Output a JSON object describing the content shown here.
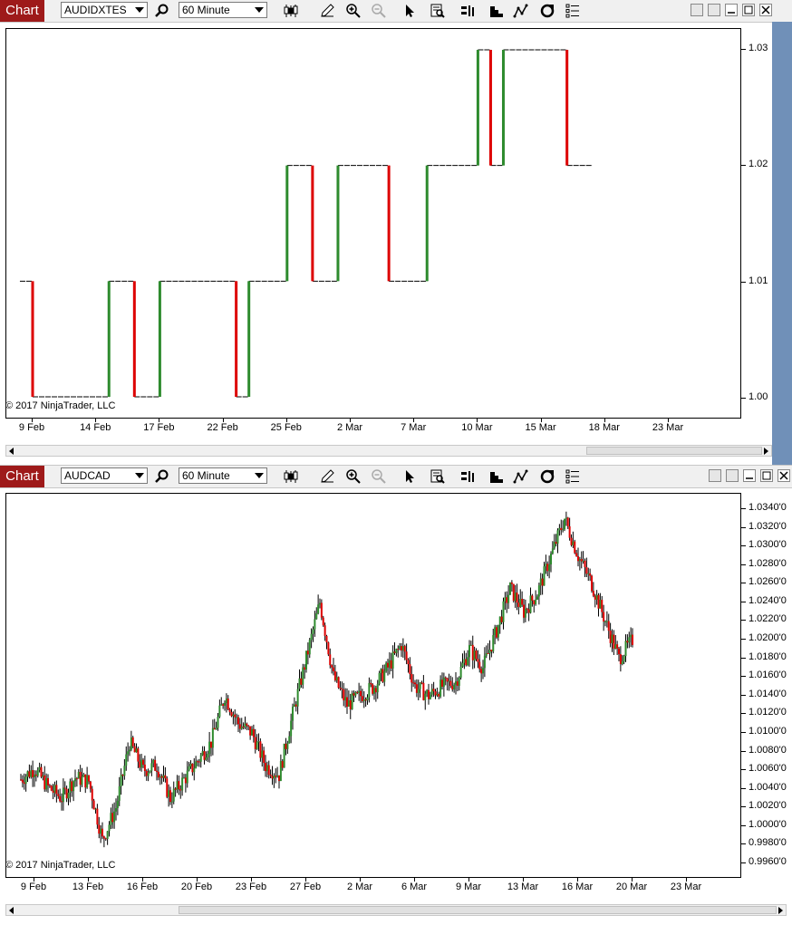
{
  "windows": [
    {
      "title": "Chart",
      "instrument": "AUDIDXTES",
      "interval": "60 Minute",
      "copyright": "© 2017 NinjaTrader, LLC",
      "y_labels": [
        "1.03",
        "1.02",
        "1.01",
        "1.00"
      ],
      "x_labels": [
        "9 Feb",
        "14 Feb",
        "17 Feb",
        "22 Feb",
        "25 Feb",
        "2 Mar",
        "7 Mar",
        "10 Mar",
        "15 Mar",
        "18 Mar",
        "23 Mar"
      ]
    },
    {
      "title": "Chart",
      "instrument": "AUDCAD",
      "interval": "60 Minute",
      "copyright": "© 2017 NinjaTrader, LLC",
      "y_labels": [
        "1.0340'0",
        "1.0320'0",
        "1.0300'0",
        "1.0280'0",
        "1.0260'0",
        "1.0240'0",
        "1.0220'0",
        "1.0200'0",
        "1.0180'0",
        "1.0160'0",
        "1.0140'0",
        "1.0120'0",
        "1.0100'0",
        "1.0080'0",
        "1.0060'0",
        "1.0040'0",
        "1.0020'0",
        "1.0000'0",
        "0.9980'0",
        "0.9960'0"
      ],
      "x_labels": [
        "9 Feb",
        "13 Feb",
        "16 Feb",
        "20 Feb",
        "23 Feb",
        "27 Feb",
        "2 Mar",
        "6 Mar",
        "9 Mar",
        "13 Mar",
        "16 Mar",
        "20 Mar",
        "23 Mar"
      ]
    }
  ],
  "toolbar_icons": [
    "bar-style-icon",
    "draw-pencil-icon",
    "zoom-in-icon",
    "zoom-out-icon",
    "select-arrow-icon",
    "data-box-icon",
    "chart-trader-icon",
    "level2-icon",
    "strategy-icon",
    "indicators-icon",
    "properties-icon"
  ],
  "colors": {
    "title_bg": "#9e1a1a",
    "up": "#2e8b2e",
    "down": "#dd0000",
    "wick": "#000000"
  },
  "chart_data": [
    {
      "type": "candlestick",
      "instrument": "AUDIDXTES",
      "ylim": [
        1.0,
        1.03
      ],
      "x_ticks": [
        "9 Feb",
        "14 Feb",
        "17 Feb",
        "22 Feb",
        "25 Feb",
        "2 Mar",
        "7 Mar",
        "10 Mar",
        "15 Mar",
        "18 Mar",
        "23 Mar"
      ],
      "y_ticks": [
        1.03,
        1.02,
        1.01,
        1.0
      ],
      "price_path": [
        [
          "8 Feb",
          1.01
        ],
        [
          "9 Feb",
          1.0
        ],
        [
          "15 Feb",
          1.01
        ],
        [
          "17 Feb",
          1.0
        ],
        [
          "19 Feb",
          1.01
        ],
        [
          "25 Feb",
          1.0
        ],
        [
          "26 Feb",
          1.01
        ],
        [
          "1 Mar",
          1.02
        ],
        [
          "3 Mar",
          1.01
        ],
        [
          "5 Mar",
          1.02
        ],
        [
          "9 Mar",
          1.01
        ],
        [
          "12 Mar",
          1.02
        ],
        [
          "16 Mar",
          1.03
        ],
        [
          "17 Mar",
          1.02
        ],
        [
          "18 Mar",
          1.03
        ],
        [
          "23 Mar",
          1.02
        ]
      ]
    },
    {
      "type": "candlestick",
      "instrument": "AUDCAD",
      "ylim": [
        0.995,
        1.035
      ],
      "x_ticks": [
        "9 Feb",
        "13 Feb",
        "16 Feb",
        "20 Feb",
        "23 Feb",
        "27 Feb",
        "2 Mar",
        "6 Mar",
        "9 Mar",
        "13 Mar",
        "16 Mar",
        "20 Mar",
        "23 Mar"
      ],
      "y_ticks": [
        1.034,
        1.032,
        1.03,
        1.028,
        1.026,
        1.024,
        1.022,
        1.02,
        1.018,
        1.016,
        1.014,
        1.012,
        1.01,
        1.008,
        1.006,
        1.004,
        1.002,
        1.0,
        0.998,
        0.996
      ],
      "price_path": [
        [
          "8 Feb",
          1.005
        ],
        [
          "9 Feb",
          1.0062
        ],
        [
          "10 Feb",
          1.0042
        ],
        [
          "11 Feb",
          1.003
        ],
        [
          "12 Feb",
          1.0052
        ],
        [
          "13 Feb",
          1.0048
        ],
        [
          "14 Feb",
          0.9985
        ],
        [
          "15 Feb",
          1.002
        ],
        [
          "16 Feb",
          1.009
        ],
        [
          "17 Feb",
          1.006
        ],
        [
          "18 Feb",
          1.0065
        ],
        [
          "19 Feb",
          1.003
        ],
        [
          "20 Feb",
          1.005
        ],
        [
          "21 Feb",
          1.007
        ],
        [
          "22 Feb",
          1.009
        ],
        [
          "23 Feb",
          1.014
        ],
        [
          "24 Feb",
          1.011
        ],
        [
          "25 Feb",
          1.01
        ],
        [
          "26 Feb",
          1.0065
        ],
        [
          "27 Feb",
          1.0055
        ],
        [
          "28 Feb",
          1.012
        ],
        [
          "1 Mar",
          1.018
        ],
        [
          "2 Mar",
          1.024
        ],
        [
          "3 Mar",
          1.016
        ],
        [
          "4 Mar",
          1.013
        ],
        [
          "6 Mar",
          1.015
        ],
        [
          "7 Mar",
          1.017
        ],
        [
          "8 Mar",
          1.0195
        ],
        [
          "9 Mar",
          1.015
        ],
        [
          "10 Mar",
          1.014
        ],
        [
          "11 Mar",
          1.015
        ],
        [
          "12 Mar",
          1.0155
        ],
        [
          "13 Mar",
          1.019
        ],
        [
          "14 Mar",
          1.017
        ],
        [
          "15 Mar",
          1.021
        ],
        [
          "16 Mar",
          1.0255
        ],
        [
          "17 Mar",
          1.023
        ],
        [
          "18 Mar",
          1.025
        ],
        [
          "19 Mar",
          1.029
        ],
        [
          "20 Mar",
          1.033
        ],
        [
          "21 Mar",
          1.029
        ],
        [
          "22 Mar",
          1.026
        ],
        [
          "23 Mar",
          1.022
        ],
        [
          "24 Mar",
          1.018
        ],
        [
          "25 Mar",
          1.02
        ]
      ]
    }
  ]
}
